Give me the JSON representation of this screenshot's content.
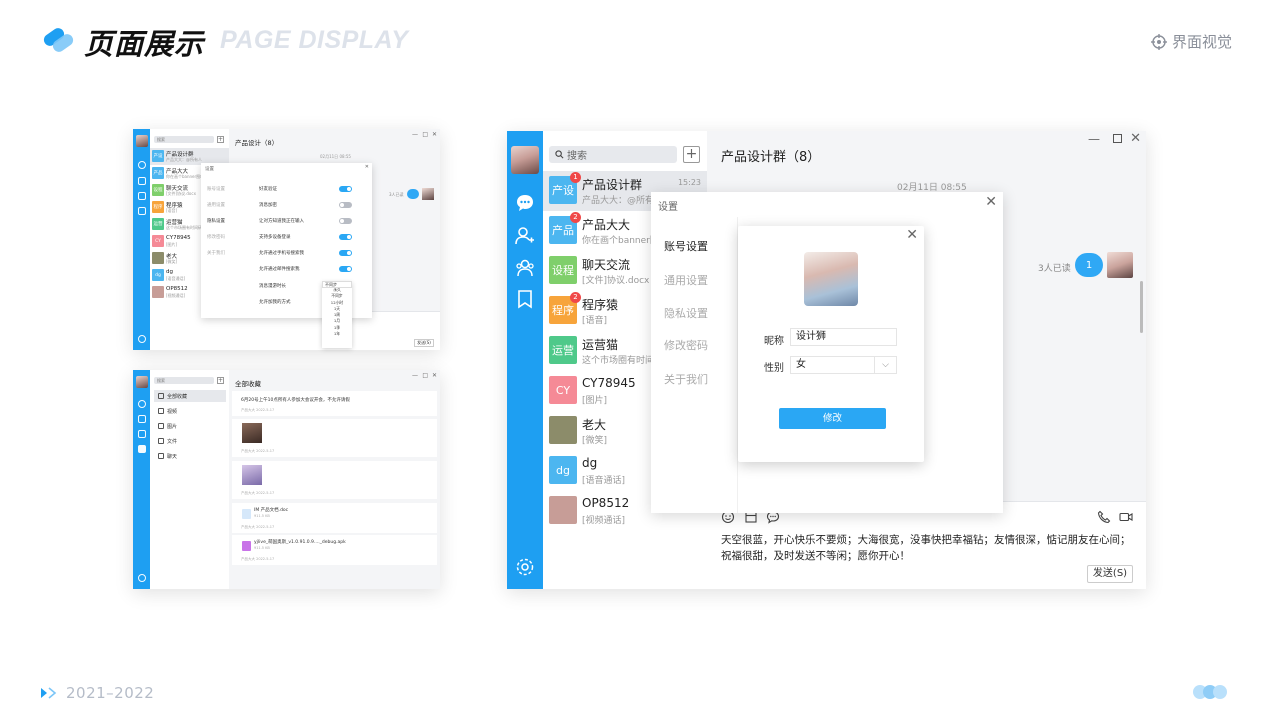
{
  "slide": {
    "title": "页面展示",
    "subtitle": "PAGE DISPLAY",
    "brand": "界面视觉",
    "years": "2021–2022"
  },
  "main": {
    "search_placeholder": "搜索",
    "chat_title": "产品设计群（8）",
    "date": "02月11日 08:55",
    "read_text": "3人已读",
    "bubble": "1",
    "input_text": "天空很蓝，开心快乐不要烦；大海很宽，没事快把幸福钻；友情很深，惦记朋友在心间；祝福很甜，及时发送不等闲；愿你开心！",
    "send_label": "发送(S)",
    "contacts": [
      {
        "avatar_text": "产设",
        "name": "产品设计群",
        "sub": "产品大大：@所有人",
        "time": "15:23",
        "badge": "1",
        "color": "#4cb6f0"
      },
      {
        "avatar_text": "产品",
        "name": "产品大大",
        "sub": "你在画个banner图吧",
        "time": "",
        "badge": "2",
        "color": "#4cb6f0"
      },
      {
        "avatar_text": "设程",
        "name": "聊天交流",
        "sub": "[文件]协议.docx",
        "time": "",
        "badge": "",
        "color": "#7fcf6b"
      },
      {
        "avatar_text": "程序",
        "name": "程序猿",
        "sub": "[语音]",
        "time": "",
        "badge": "2",
        "color": "#f7a43b"
      },
      {
        "avatar_text": "运营",
        "name": "运营猫",
        "sub": "这个市场圈有时间研究下",
        "time": "",
        "badge": "",
        "color": "#4fc98a"
      },
      {
        "avatar_text": "CY",
        "name": "CY78945",
        "sub": "[图片]",
        "time": "",
        "badge": "",
        "color": "#f58a96"
      },
      {
        "avatar_text": "",
        "name": "老大",
        "sub": "[微笑]",
        "time": "",
        "badge": "",
        "color": "#8c8c6a"
      },
      {
        "avatar_text": "dg",
        "name": "dg",
        "sub": "[语音通话]",
        "time": "",
        "badge": "",
        "color": "#4cb6f0"
      },
      {
        "avatar_text": "",
        "name": "OP8512",
        "sub": "[视频通话]",
        "time": "",
        "badge": "",
        "color": "#c79d97"
      }
    ],
    "settings": {
      "title": "设置",
      "nav": [
        "账号设置",
        "通用设置",
        "隐私设置",
        "修改密码",
        "关于我们"
      ]
    },
    "profile": {
      "nickname_label": "昵称",
      "nickname_value": "设计狮",
      "gender_label": "性别",
      "gender_value": "女",
      "submit_label": "修改"
    }
  },
  "small1": {
    "search": "搜索",
    "title": "产品设计（8）",
    "date": "02月11日 08:55",
    "read": "3人已读",
    "send": "发送(S)",
    "contacts": [
      {
        "avatar_text": "产设",
        "name": "产品设计群",
        "sub": "产品大大：@所有人",
        "color": "#4cb6f0"
      },
      {
        "avatar_text": "产品",
        "name": "产品大大",
        "sub": "你在画个banner图吧",
        "color": "#4cb6f0"
      },
      {
        "avatar_text": "设程",
        "name": "聊天交流",
        "sub": "[文件]协议.docx",
        "color": "#7fcf6b"
      },
      {
        "avatar_text": "程序",
        "name": "程序猿",
        "sub": "[语音]",
        "color": "#f7a43b"
      },
      {
        "avatar_text": "运营",
        "name": "运营猫",
        "sub": "这个市场圈有时间研究下",
        "color": "#4fc98a"
      },
      {
        "avatar_text": "CY",
        "name": "CY78945",
        "sub": "[图片]",
        "color": "#f58a96"
      },
      {
        "avatar_text": "",
        "name": "老大",
        "sub": "[微笑]",
        "color": "#8c8c6a"
      },
      {
        "avatar_text": "dg",
        "name": "dg",
        "sub": "[语音通话]",
        "color": "#4cb6f0"
      },
      {
        "avatar_text": "",
        "name": "OP8512",
        "sub": "[视频通话]",
        "color": "#c79d97"
      }
    ],
    "settings_title": "设置",
    "nav": [
      "账号设置",
      "通用设置",
      "隐私设置",
      "修改密码",
      "关于我们"
    ],
    "options": [
      {
        "label": "好友验证",
        "on": true
      },
      {
        "label": "消息加密",
        "on": false
      },
      {
        "label": "让对方知道我正在输入",
        "on": false
      },
      {
        "label": "支持多设备登录",
        "on": true
      },
      {
        "label": "允许通过手机号搜索我",
        "on": true
      },
      {
        "label": "允许通过邮件搜索我",
        "on": true
      }
    ],
    "retention_label": "消息漫游时长",
    "retention_value": "不同步",
    "mode_label": "允许加我的方式",
    "retention_options": [
      "永久",
      "不同步",
      "12小时",
      "1天",
      "1周",
      "1月",
      "1季",
      "1年"
    ]
  },
  "small2": {
    "search": "搜索",
    "title": "全部收藏",
    "nav": [
      "全部收藏",
      "视频",
      "图片",
      "文件",
      "聊天"
    ],
    "cards": [
      {
        "text": "6月20号上午10点所有人参加大会议开会，不允许请假",
        "meta": "产品大大 2022-5-17",
        "kind": "text"
      },
      {
        "text": "",
        "meta": "产品大大 2022-5-17",
        "kind": "image"
      },
      {
        "text": "",
        "meta": "产品大大 2022-5-17",
        "kind": "image2"
      },
      {
        "text": "IM 产品文档.doc",
        "sub": "911.5 KB",
        "meta": "产品大大 2022-5-17",
        "kind": "file"
      },
      {
        "text": "yjlive_萌国奥斯_v1.0.91.0.9...._debug.apk",
        "sub": "911.5 KB",
        "meta": "产品大大 2022-5-17",
        "kind": "apk"
      }
    ]
  },
  "colors": {
    "rail": "#1e9ff2",
    "accent": "#2aa7f4",
    "badge": "#f04848"
  }
}
